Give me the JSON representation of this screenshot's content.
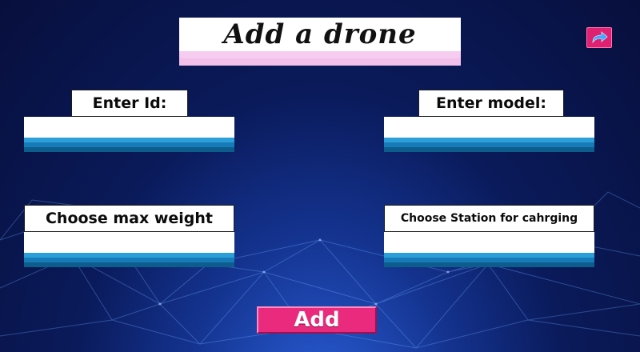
{
  "title": "Add a drone",
  "back_button": {
    "icon": "redo-arrow-icon"
  },
  "fields": {
    "id": {
      "label": "Enter Id:",
      "value": ""
    },
    "model": {
      "label": "Enter model:",
      "value": ""
    },
    "max_weight": {
      "label": "Choose max weight",
      "value": ""
    },
    "station": {
      "label": "Choose Station for cahrging",
      "value": ""
    }
  },
  "add_button": {
    "label": "Add"
  },
  "colors": {
    "accent": "#ea2a7c",
    "field_stripe_light": "#2c9fd8",
    "field_stripe_mid": "#167bb8",
    "field_stripe_dark": "#0d5d8c",
    "title_stripe": "#f4c6ee"
  }
}
